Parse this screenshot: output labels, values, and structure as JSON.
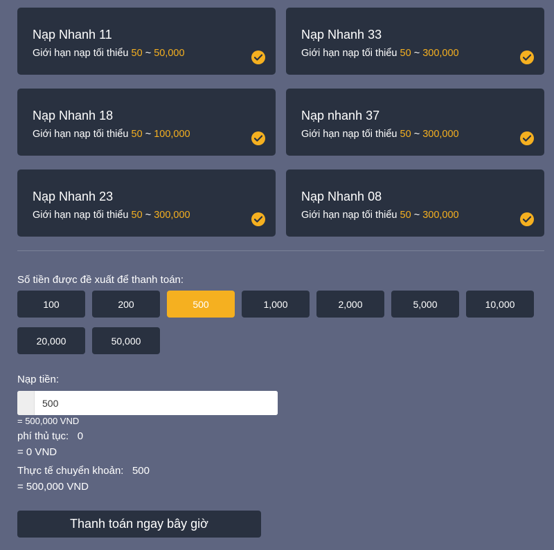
{
  "channels": [
    {
      "title": "Nạp Nhanh 11",
      "limit_label": "Giới hạn nạp tối thiểu",
      "min": "50",
      "sep": "~",
      "max": "50,000"
    },
    {
      "title": "Nạp Nhanh 33",
      "limit_label": "Giới hạn nạp tối thiểu",
      "min": "50",
      "sep": "~",
      "max": "300,000"
    },
    {
      "title": "Nạp Nhanh 18",
      "limit_label": "Giới hạn nạp tối thiểu",
      "min": "50",
      "sep": "~",
      "max": "100,000"
    },
    {
      "title": "Nạp nhanh 37",
      "limit_label": "Giới hạn nạp tối thiểu",
      "min": "50",
      "sep": "~",
      "max": "300,000"
    },
    {
      "title": "Nạp Nhanh 23",
      "limit_label": "Giới hạn nạp tối thiểu",
      "min": "50",
      "sep": "~",
      "max": "300,000"
    },
    {
      "title": "Nạp Nhanh 08",
      "limit_label": "Giới hạn nạp tối thiểu",
      "min": "50",
      "sep": "~",
      "max": "300,000"
    }
  ],
  "channel_icon": "check-circle-icon",
  "suggest": {
    "label": "Số tiền được đề xuất để thanh toán:",
    "amounts": [
      "100",
      "200",
      "500",
      "1,000",
      "2,000",
      "5,000",
      "10,000",
      "20,000",
      "50,000"
    ],
    "selected": "500"
  },
  "deposit": {
    "label": "Nạp tiền:",
    "value": "500",
    "converted": "= 500,000 VND"
  },
  "fee": {
    "label": "phí thủ tục:   0",
    "converted": "= 0 VND"
  },
  "actual": {
    "label": "Thực tế chuyển khoản:   500",
    "converted": "= 500,000 VND"
  },
  "pay_button": "Thanh toán ngay bây giờ",
  "colors": {
    "background": "#5e6580",
    "card": "#293140",
    "accent": "#f5b020",
    "text": "#ffffff"
  }
}
